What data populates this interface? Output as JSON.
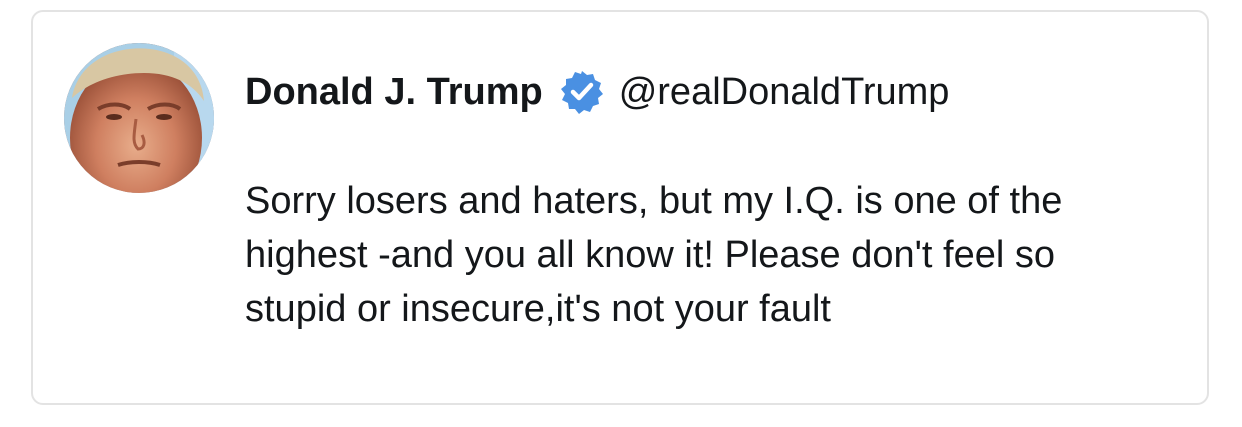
{
  "tweet": {
    "author": {
      "display_name": "Donald J. Trump",
      "handle": "@realDonaldTrump",
      "verified": true,
      "verified_badge_icon": "verified-badge-icon",
      "avatar_icon": "profile-photo"
    },
    "text_lines": [
      "Sorry losers and haters, but my I.Q. is one of the",
      "highest -and you all know it! Please don't feel so",
      "stupid or insecure,it's not your fault"
    ]
  },
  "colors": {
    "verified_blue": "#4a90e2",
    "text": "#14171a",
    "border": "#e3e3e3"
  }
}
